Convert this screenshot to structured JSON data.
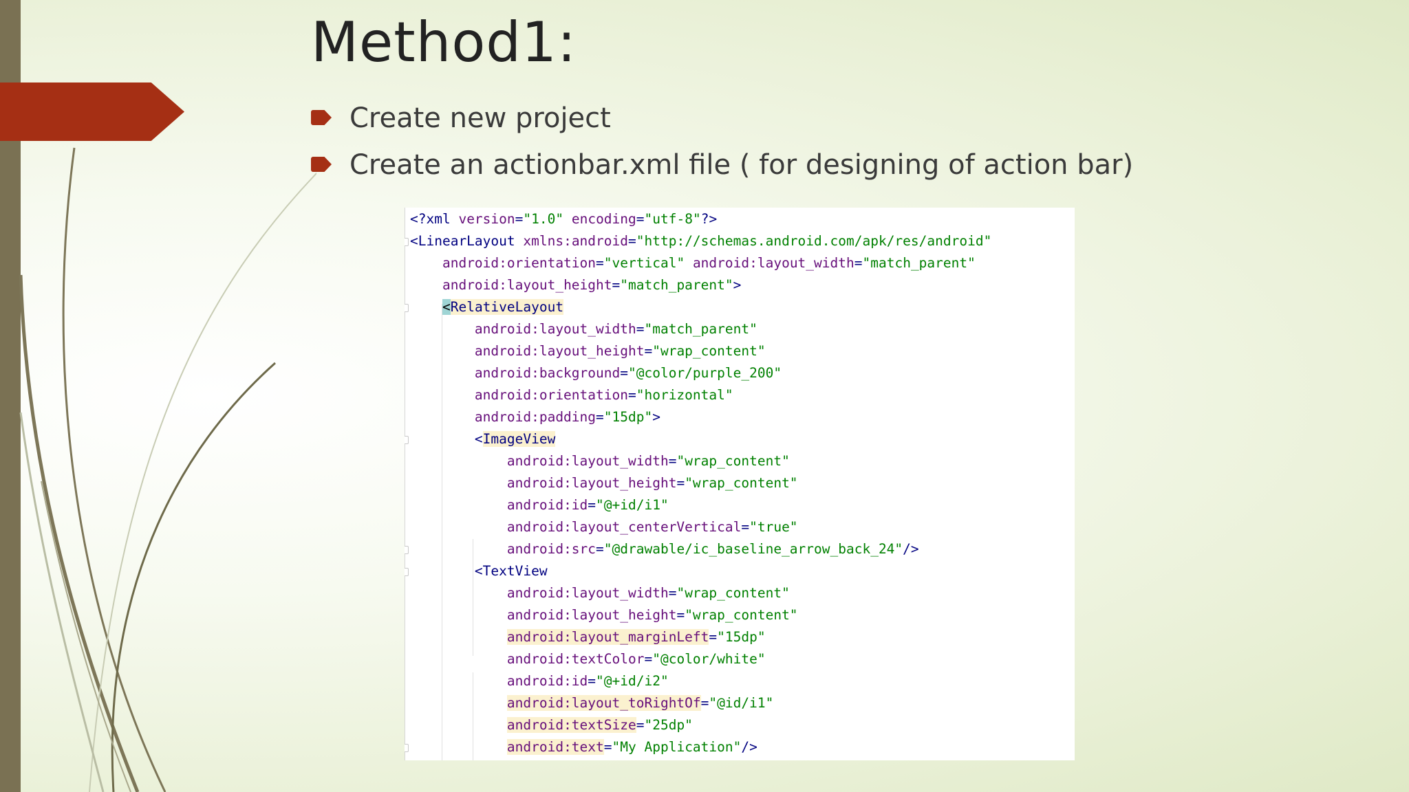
{
  "slide": {
    "title": "Method1:",
    "bullets": [
      "Create new project",
      "Create an actionbar.xml file ( for designing of action bar)"
    ]
  },
  "code": {
    "lines": [
      "<?xml version=\"1.0\" encoding=\"utf-8\"?>",
      "<LinearLayout xmlns:android=\"http://schemas.android.com/apk/res/android\"",
      "    android:orientation=\"vertical\" android:layout_width=\"match_parent\"",
      "    android:layout_height=\"match_parent\">",
      "    <RelativeLayout",
      "        android:layout_width=\"match_parent\"",
      "        android:layout_height=\"wrap_content\"",
      "        android:background=\"@color/purple_200\"",
      "        android:orientation=\"horizontal\"",
      "        android:padding=\"15dp\">",
      "        <ImageView",
      "            android:layout_width=\"wrap_content\"",
      "            android:layout_height=\"wrap_content\"",
      "            android:id=\"@+id/i1\"",
      "            android:layout_centerVertical=\"true\"",
      "            android:src=\"@drawable/ic_baseline_arrow_back_24\"/>",
      "        <TextView",
      "            android:layout_width=\"wrap_content\"",
      "            android:layout_height=\"wrap_content\"",
      "            android:layout_marginLeft=\"15dp\"",
      "            android:textColor=\"@color/white\"",
      "            android:id=\"@+id/i2\"",
      "            android:layout_toRightOf=\"@id/i1\"",
      "            android:textSize=\"25dp\"",
      "            android:text=\"My Application\"/>"
    ]
  },
  "colors": {
    "accent": "#a52f14",
    "left_bar": "#7a7153",
    "xml_tag": "#000080",
    "xml_attr": "#660e7a",
    "xml_value": "#008000",
    "highlight": "#fbf1cf"
  }
}
